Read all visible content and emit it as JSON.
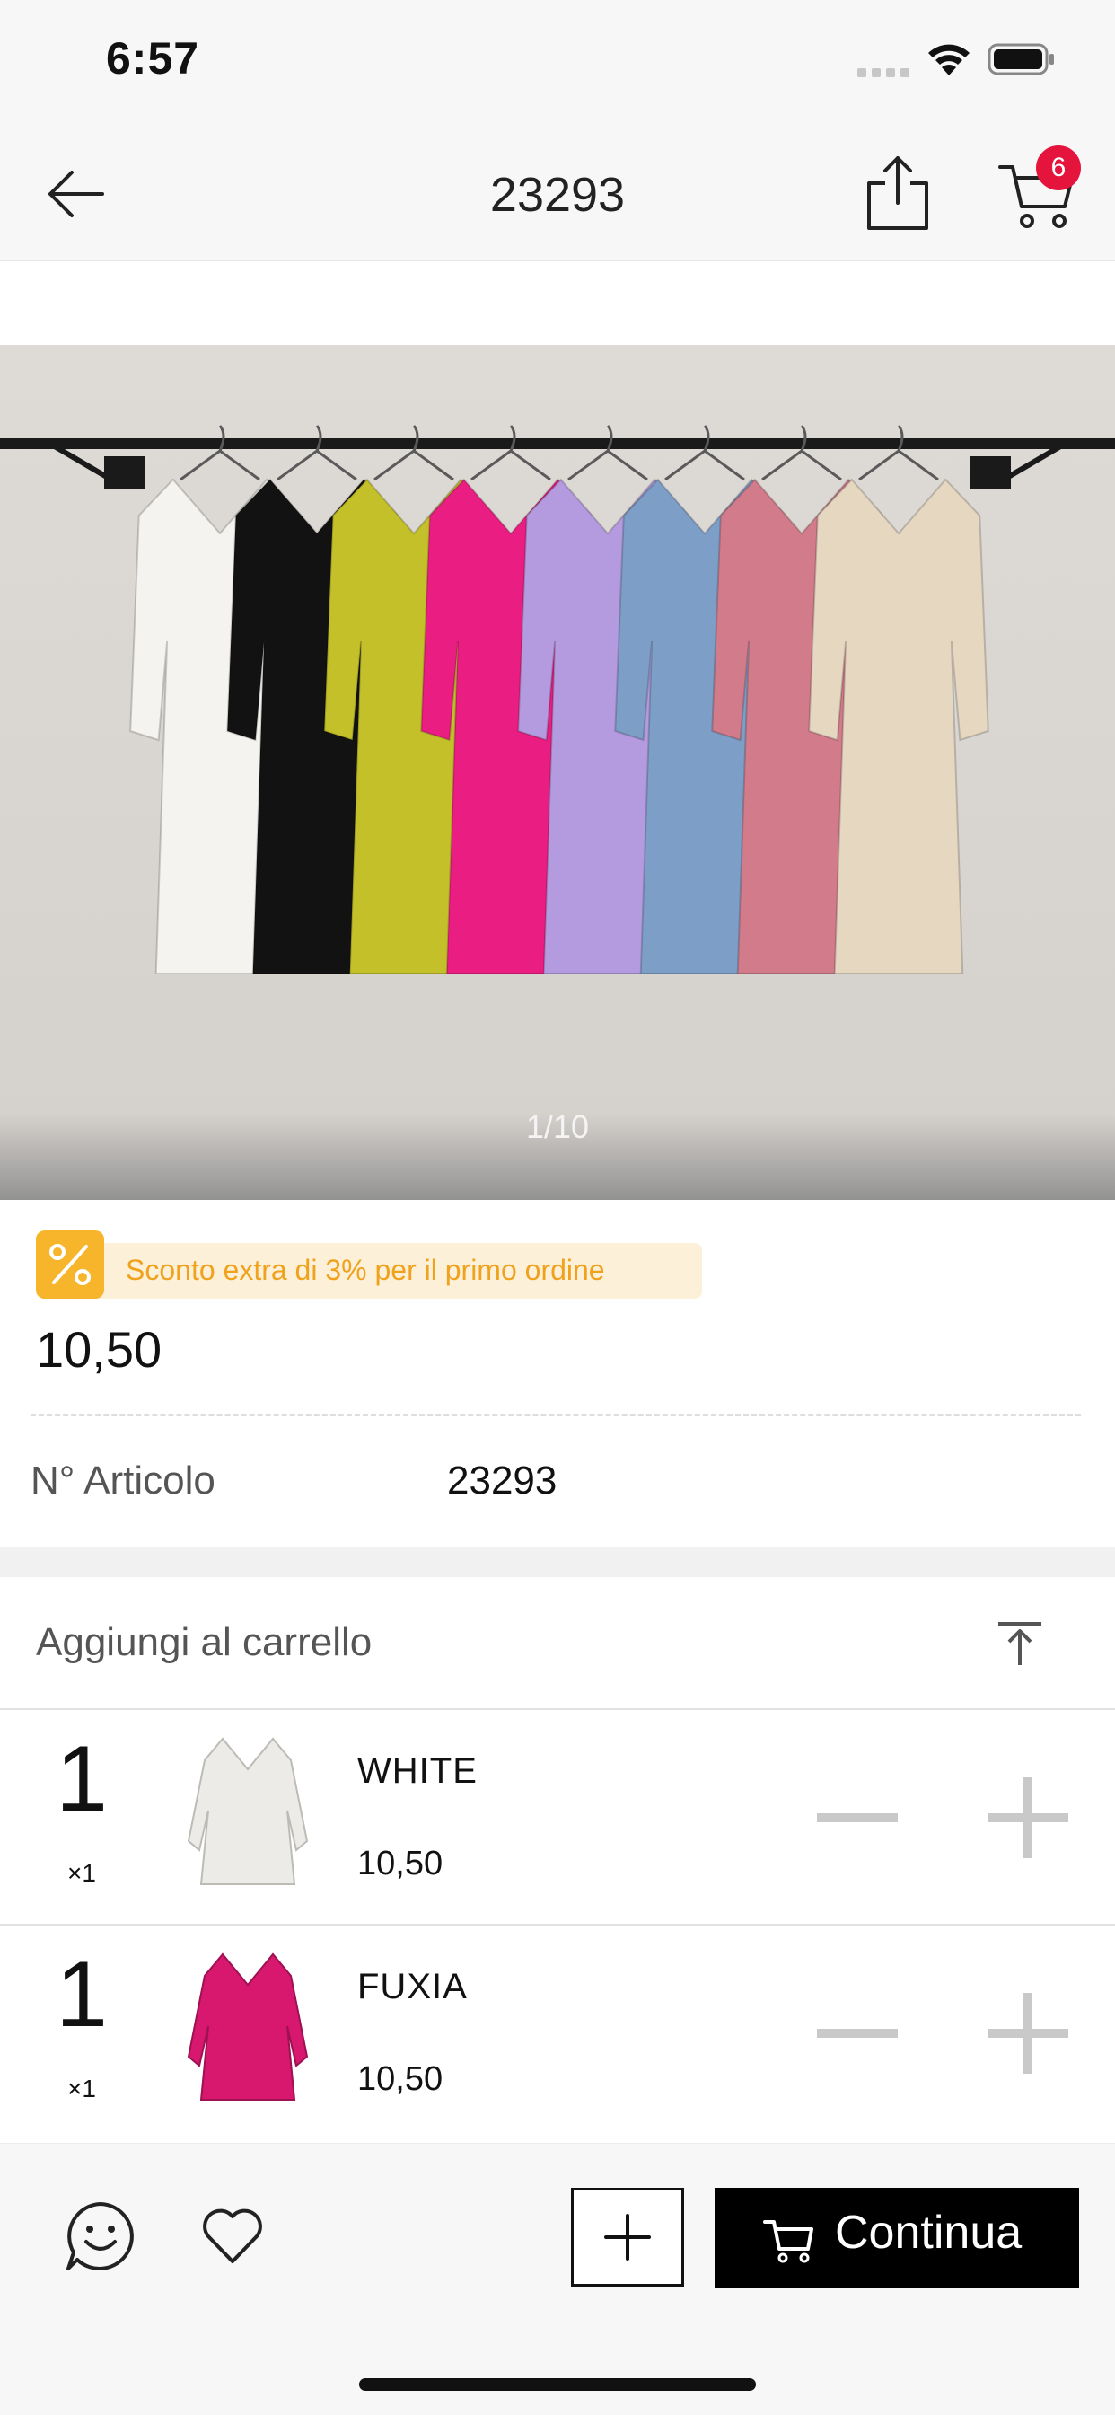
{
  "status_bar": {
    "time": "6:57"
  },
  "nav": {
    "title": "23293",
    "cart_count": "6"
  },
  "gallery": {
    "counter": "1/10"
  },
  "promo": {
    "text": "Sconto extra di 3% per il primo ordine"
  },
  "product": {
    "price": "10,50",
    "article_label": "N° Articolo",
    "article_value": "23293"
  },
  "cart_section": {
    "title": "Aggiungi al carrello",
    "items": [
      {
        "qty": "1",
        "multiplier": "×1",
        "name": "WHITE",
        "price": "10,50",
        "swatch": "#ecebe8"
      },
      {
        "qty": "1",
        "multiplier": "×1",
        "name": "FUXIA",
        "price": "10,50",
        "swatch": "#d8186e"
      }
    ]
  },
  "bottom_bar": {
    "continue_label": "Continua"
  },
  "colors": {
    "badge": "#e4143c",
    "promo_text": "#f0a21c",
    "promo_bg": "#fdf0d9",
    "garments": [
      "#f5f3ef",
      "#121212",
      "#c4c02a",
      "#ea1e82",
      "#b49be0",
      "#7d9ec6",
      "#d17b8b",
      "#e6d7c1"
    ]
  }
}
